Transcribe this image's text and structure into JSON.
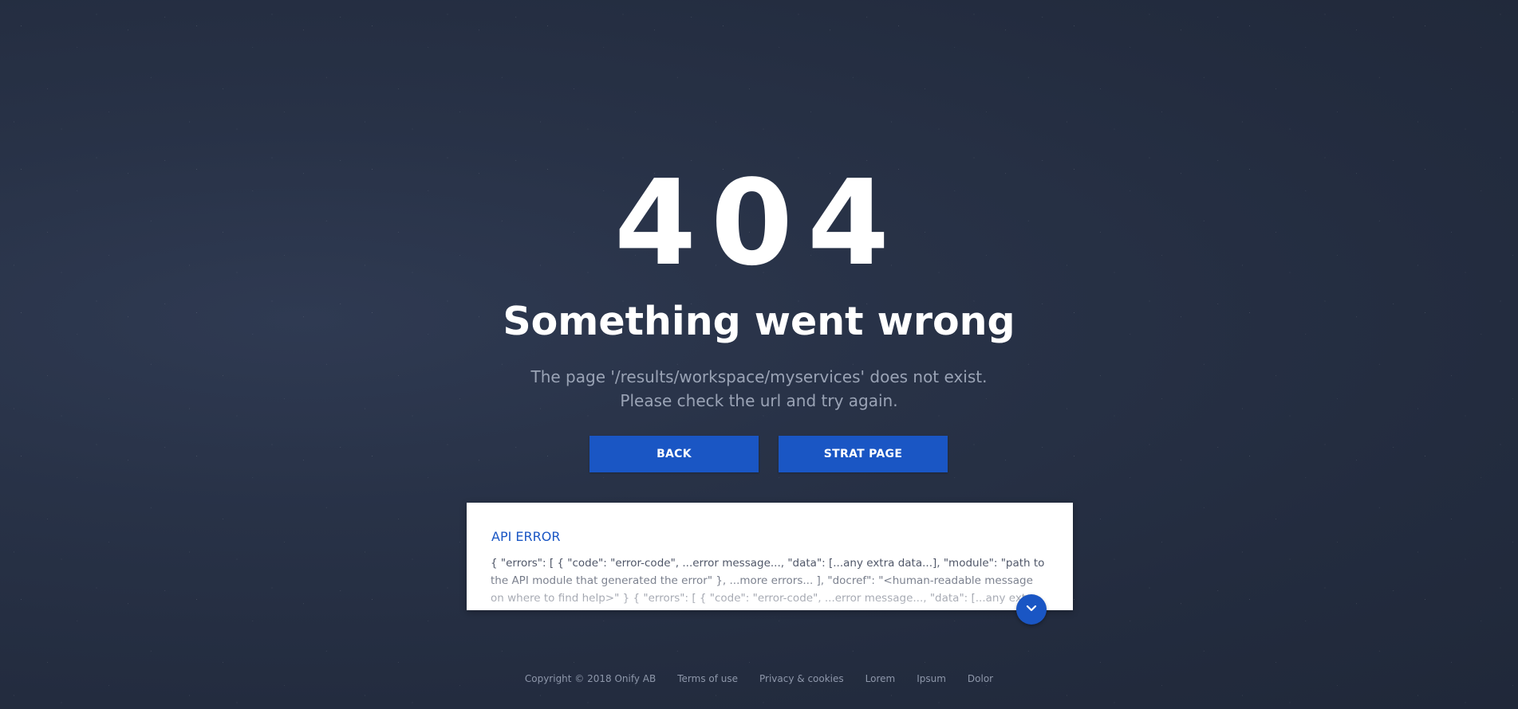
{
  "error": {
    "code": "404",
    "headline": "Something went wrong",
    "message_line1": "The page '/results/workspace/myservices' does not exist.",
    "message_line2": "Please check the url and try again."
  },
  "buttons": {
    "back_label": "BACK",
    "start_label": "STRAT PAGE"
  },
  "api_error": {
    "title": "API ERROR",
    "body": "{ \"errors\": [ { \"code\": \"error-code\", ...error message..., \"data\": [...any extra data...], \"module\": \"path to the API module that generated the error\" }, ...more errors... ], \"docref\": \"<human-readable message on where to find help>\" } { \"errors\": [ { \"code\": \"error-code\", ...error message..., \"data\": [...any extra data...], \"module\": \"path to the API module that generated the error\" }",
    "expand_icon": "chevron-down-icon"
  },
  "footer": {
    "copyright": "Copyright © 2018 Onify AB",
    "links": [
      "Terms of use",
      "Privacy & cookies",
      "Lorem",
      "Ipsum",
      "Dolor"
    ]
  },
  "colors": {
    "accent": "#1a56c4",
    "background": "#262f44",
    "muted_text": "#9aa3b5"
  }
}
